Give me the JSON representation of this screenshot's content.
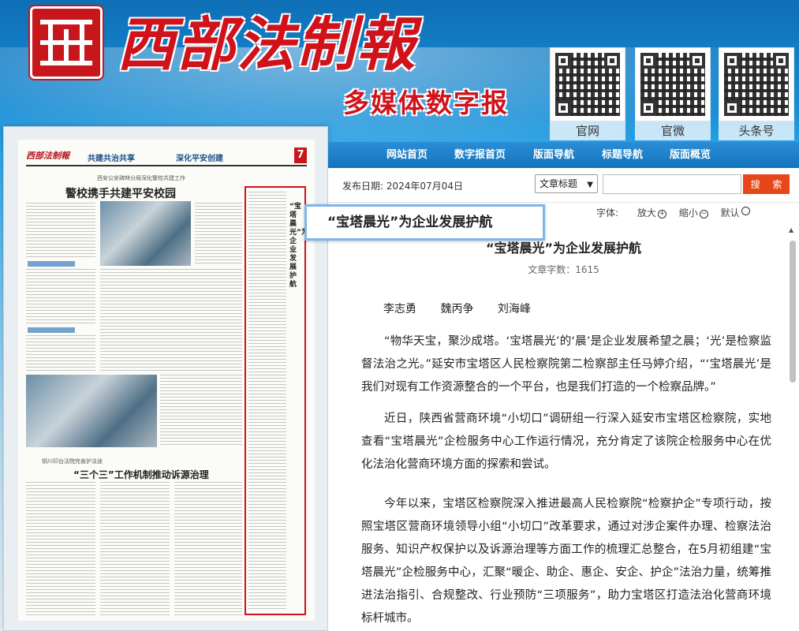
{
  "header": {
    "brand_name": "西部法制報",
    "brand_sub": "多媒体数字报",
    "qr_codes": [
      {
        "label": "官网",
        "icon": "qr-code-icon"
      },
      {
        "label": "官微",
        "icon": "qr-code-icon"
      },
      {
        "label": "头条号",
        "icon": "qr-code-icon"
      }
    ]
  },
  "nav": {
    "items": [
      "网站首页",
      "数字报首页",
      "版面导航",
      "标题导航",
      "版面概览"
    ]
  },
  "paper": {
    "mast_logo": "西部法制報",
    "mast_slogan1": "共建共治共享",
    "mast_slogan2": "深化平安创建",
    "page_number": "7",
    "kicker": "西安公安碑林分局深化警校共建工作",
    "headline": "警校携手共建平安校园",
    "kicker2": "铜川印台法院完善护法途",
    "headline2": "“三个三”工作机制推动诉源治理",
    "vertical_title": "“宝塔晨光”为企业发展护航"
  },
  "toolbar": {
    "pub_date_label": "发布日期:",
    "pub_date": "2024年07月04日",
    "select_value": "文章标题",
    "search_placeholder": "",
    "search_button": "搜 索"
  },
  "fontbar": {
    "label": "字体:",
    "enlarge": "放大",
    "shrink": "缩小",
    "default": "默认"
  },
  "tooltip": {
    "text": "“宝塔晨光”为企业发展护航"
  },
  "article": {
    "title": "“宝塔晨光”为企业发展护航",
    "word_count": "文章字数：1615",
    "authors": [
      "李志勇",
      "魏丙争",
      "刘海峰"
    ],
    "paragraphs": [
      "“物华天宝，聚沙成塔。‘宝塔晨光’的‘晨’是企业发展希望之晨；‘光’是检察监督法治之光。”延安市宝塔区人民检察院第二检察部主任马婷介绍，“‘宝塔晨光’是我们对现有工作资源整合的一个平台，也是我们打造的一个检察品牌。”",
      "近日，陕西省营商环境“小切口”调研组一行深入延安市宝塔区检察院，实地查看“宝塔晨光”企检服务中心工作运行情况，充分肯定了该院企检服务中心在优化法治化营商环境方面的探索和尝试。",
      "今年以来，宝塔区检察院深入推进最高人民检察院“检察护企”专项行动，按照宝塔区营商环境领导小组“小切口”改革要求，通过对涉企案件办理、检察法治服务、知识产权保护以及诉源治理等方面工作的梳理汇总整合，在5月初组建“宝塔晨光”企检服务中心，汇聚“暖企、助企、惠企、安企、护企”法治力量，统筹推进法治指引、合规整改、行业预防“三项服务”，助力宝塔区打造法治化营商环境标杆城市。"
    ]
  }
}
